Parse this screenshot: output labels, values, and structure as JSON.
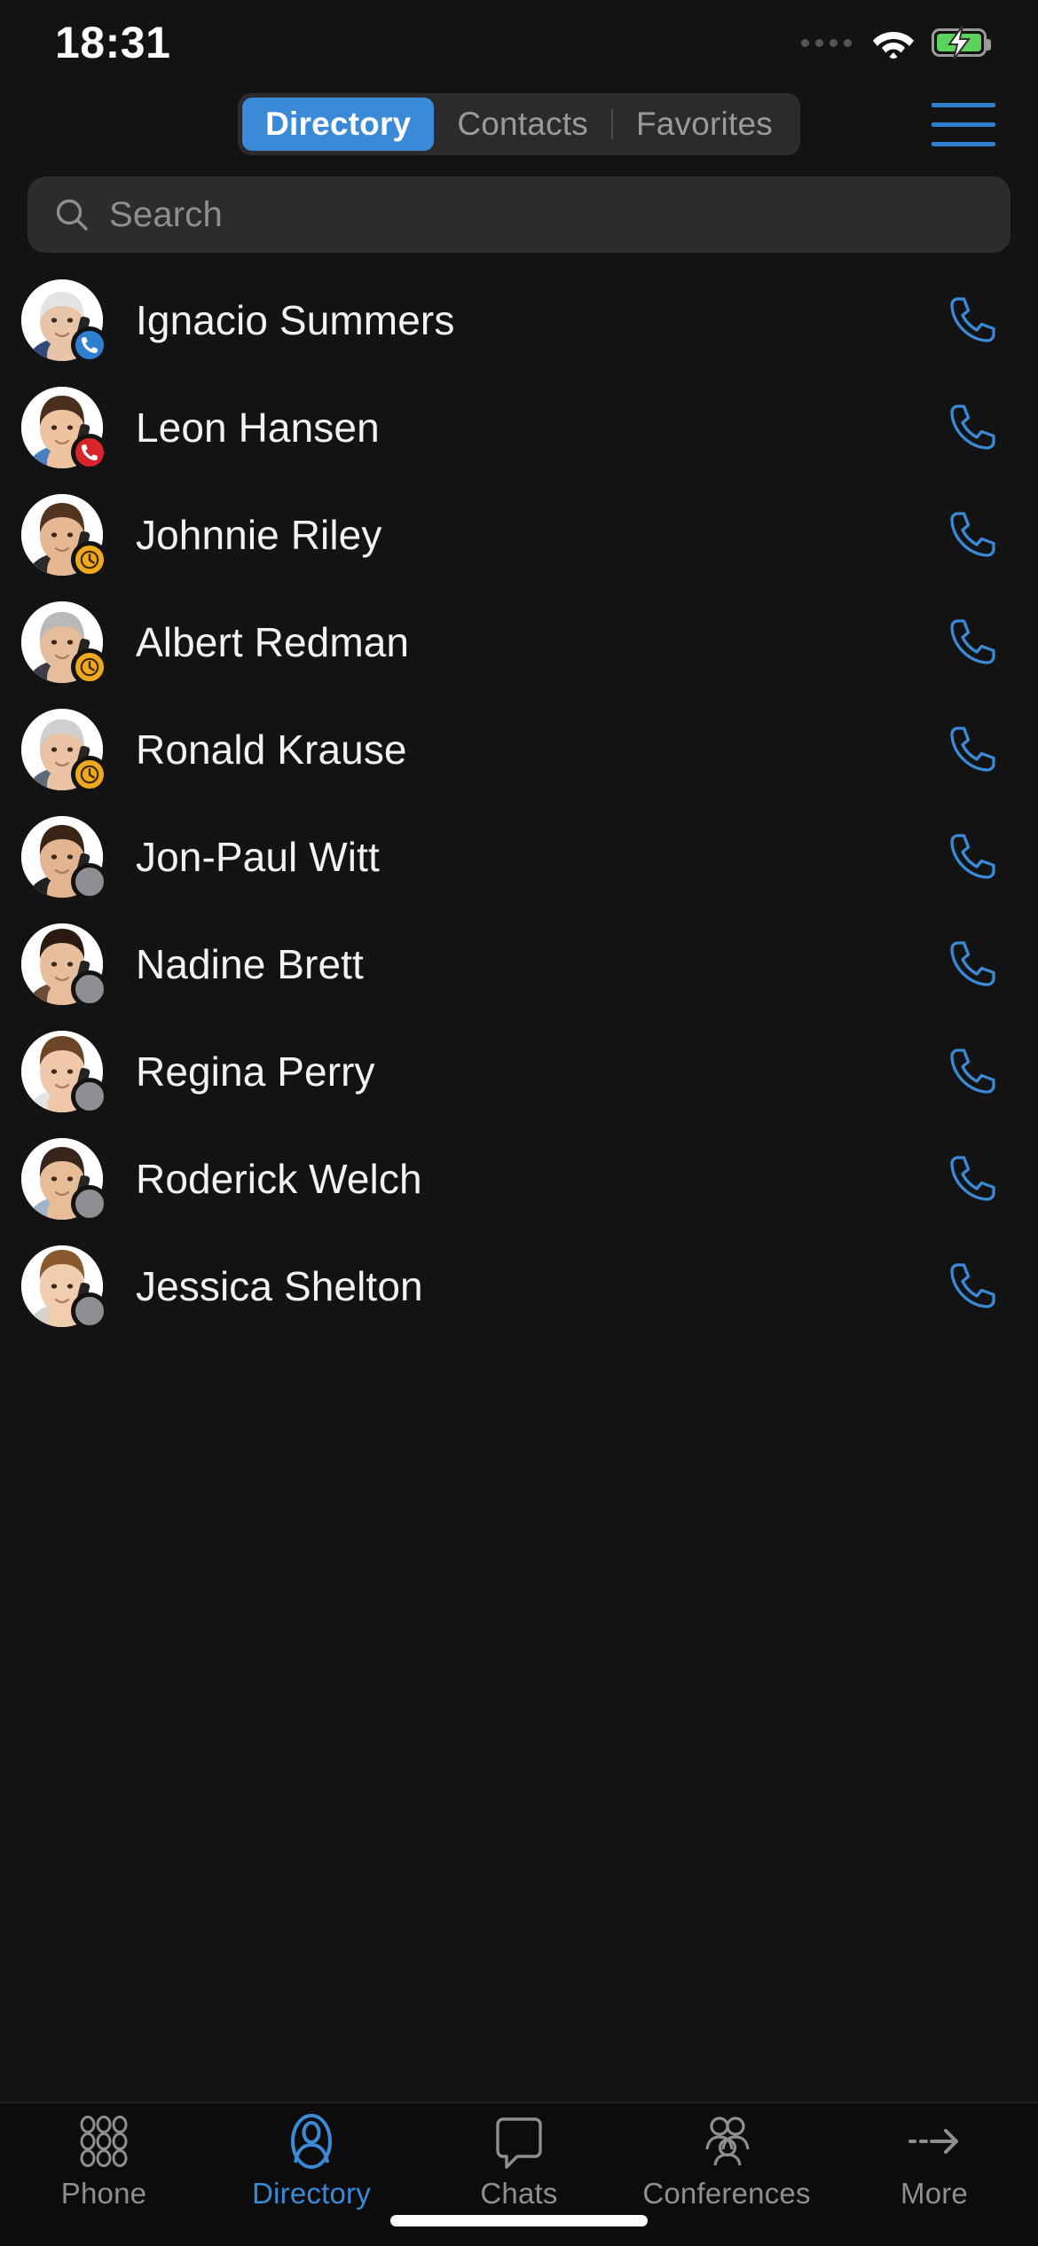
{
  "status_bar": {
    "time": "18:31",
    "signal_icon": "signal-dots-icon",
    "wifi_icon": "wifi-icon",
    "battery_icon": "battery-charging-icon",
    "battery_color": "#5bd25b"
  },
  "header": {
    "segments": [
      {
        "label": "Directory",
        "active": true
      },
      {
        "label": "Contacts",
        "active": false
      },
      {
        "label": "Favorites",
        "active": false
      }
    ],
    "menu_icon": "hamburger-menu-icon",
    "accent_color": "#3b8ad8"
  },
  "search": {
    "placeholder": "Search",
    "value": "",
    "icon": "search-icon"
  },
  "contacts": {
    "call_icon": "phone-call-icon",
    "items": [
      {
        "name": "Ignacio Summers",
        "status": "on-call",
        "badge_icon": "phone-icon",
        "badge_color": "#2f7fd0",
        "avatar": "elderly-man-on-phone"
      },
      {
        "name": "Leon Hansen",
        "status": "busy",
        "badge_icon": "phone-icon",
        "badge_color": "#d8252b",
        "avatar": "young-man-thumbs-up"
      },
      {
        "name": "Johnnie Riley",
        "status": "away",
        "badge_icon": "clock-icon",
        "badge_color": "#f0a81e",
        "avatar": "bearded-man-smiling"
      },
      {
        "name": "Albert Redman",
        "status": "away",
        "badge_icon": "clock-icon",
        "badge_color": "#f0a81e",
        "avatar": "man-with-glasses"
      },
      {
        "name": "Ronald Krause",
        "status": "away",
        "badge_icon": "clock-icon",
        "badge_color": "#f0a81e",
        "avatar": "grey-haired-man"
      },
      {
        "name": "Jon-Paul Witt",
        "status": "offline",
        "badge_icon": "circle-icon",
        "badge_color": "#8e8e93",
        "avatar": "man-in-suit"
      },
      {
        "name": "Nadine Brett",
        "status": "offline",
        "badge_icon": "circle-icon",
        "badge_color": "#8e8e93",
        "avatar": "woman-on-phone"
      },
      {
        "name": "Regina Perry",
        "status": "offline",
        "badge_icon": "circle-icon",
        "badge_color": "#8e8e93",
        "avatar": "woman-smiling"
      },
      {
        "name": "Roderick Welch",
        "status": "offline",
        "badge_icon": "circle-icon",
        "badge_color": "#8e8e93",
        "avatar": "man-with-headset"
      },
      {
        "name": "Jessica Shelton",
        "status": "offline",
        "badge_icon": "circle-icon",
        "badge_color": "#8e8e93",
        "avatar": "woman-long-hair"
      }
    ]
  },
  "tabbar": {
    "items": [
      {
        "label": "Phone",
        "icon": "keypad-icon",
        "active": false
      },
      {
        "label": "Directory",
        "icon": "person-icon",
        "active": true
      },
      {
        "label": "Chats",
        "icon": "chat-bubble-icon",
        "active": false
      },
      {
        "label": "Conferences",
        "icon": "people-group-icon",
        "active": false
      },
      {
        "label": "More",
        "icon": "arrow-right-icon",
        "active": false
      }
    ],
    "active_color": "#3b8ad8",
    "inactive_color": "#8e8e93"
  }
}
